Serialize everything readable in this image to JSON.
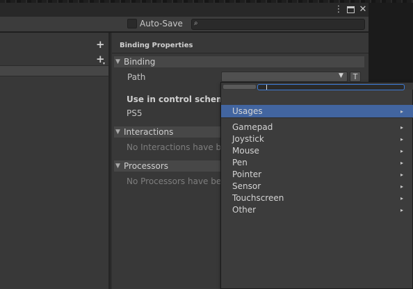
{
  "toolbar": {
    "auto_save_label": "Auto-Save",
    "search_placeholder": "",
    "search_icon": "search-icon"
  },
  "window_controls": {
    "menu_glyph": "⋮",
    "maximize_glyph": "□",
    "close_glyph": "✕"
  },
  "left": {
    "add_glyph": "+",
    "add_binding_glyph": "+"
  },
  "properties": {
    "title": "Binding Properties",
    "binding": {
      "section_label": "Binding",
      "path_label": "Path",
      "path_value": "",
      "t_button_label": "T"
    },
    "control_scheme": {
      "label": "Use in control scheme",
      "scheme": "PS5"
    },
    "interactions": {
      "section_label": "Interactions",
      "empty_text": "No Interactions have bee"
    },
    "processors": {
      "section_label": "Processors",
      "empty_text": "No Processors have bee"
    }
  },
  "popup": {
    "search_value": "",
    "selected_item": "Usages",
    "items": [
      "Gamepad",
      "Joystick",
      "Mouse",
      "Pen",
      "Pointer",
      "Sensor",
      "Touchscreen",
      "Other"
    ],
    "submenu_arrow": "▸"
  },
  "colors": {
    "selection": "#4265a0",
    "focus_border": "#3d7bd6",
    "panel": "#383838"
  }
}
